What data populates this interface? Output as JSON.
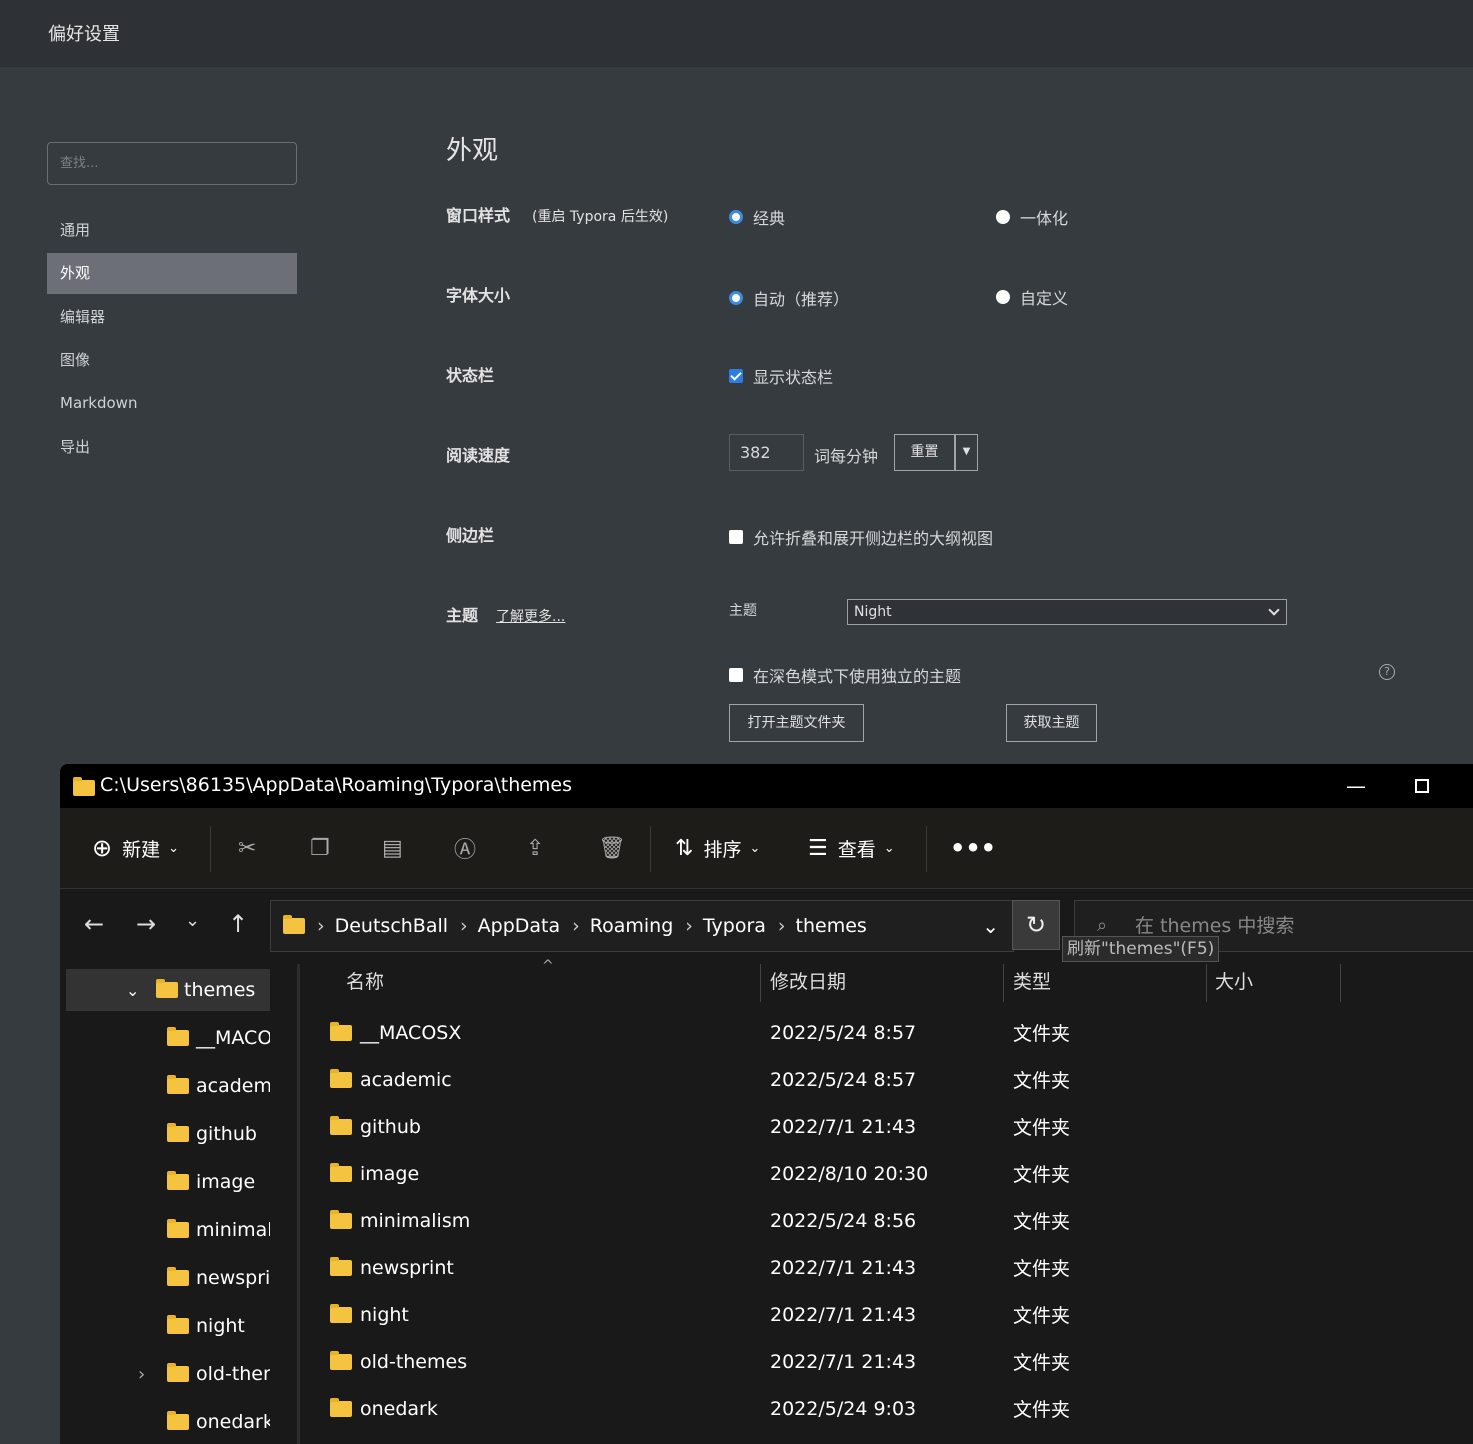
{
  "typora": {
    "window_title": "偏好设置",
    "search_placeholder": "查找...",
    "nav": [
      "通用",
      "外观",
      "编辑器",
      "图像",
      "Markdown",
      "导出"
    ],
    "section_title": "外观",
    "window_style": {
      "label": "窗口样式",
      "note": "(重启 Typora 后生效)",
      "options": [
        "经典",
        "一体化"
      ],
      "selected": "经典"
    },
    "font_size": {
      "label": "字体大小",
      "options": [
        "自动（推荐）",
        "自定义"
      ],
      "selected": "自动（推荐）"
    },
    "status_bar": {
      "label": "状态栏",
      "checkbox": "显示状态栏",
      "checked": true
    },
    "reading_speed": {
      "label": "阅读速度",
      "value": "382",
      "unit": "词每分钟",
      "reset": "重置"
    },
    "sidebar": {
      "label": "侧边栏",
      "checkbox": "允许折叠和展开侧边栏的大纲视图",
      "checked": false
    },
    "theme": {
      "label": "主题",
      "learn_more": "了解更多...",
      "select_label": "主题",
      "selected": "Night",
      "dark_checkbox": "在深色模式下使用独立的主题",
      "open_folder": "打开主题文件夹",
      "get_themes": "获取主题"
    }
  },
  "explorer": {
    "title": "C:\\Users\\86135\\AppData\\Roaming\\Typora\\themes",
    "toolbar": {
      "new": "新建",
      "sort": "排序",
      "view": "查看"
    },
    "breadcrumb": [
      "DeutschBall",
      "AppData",
      "Roaming",
      "Typora",
      "themes"
    ],
    "search_placeholder": "在 themes 中搜索",
    "tooltip": "刷新\"themes\"(F5)",
    "tree": [
      "themes",
      "__MACO",
      "academi",
      "github",
      "image",
      "minimali",
      "newsprir",
      "night",
      "old-then",
      "onedark"
    ],
    "columns": [
      "名称",
      "修改日期",
      "类型",
      "大小"
    ],
    "files": [
      {
        "name": "__MACOSX",
        "date": "2022/5/24 8:57",
        "type": "文件夹"
      },
      {
        "name": "academic",
        "date": "2022/5/24 8:57",
        "type": "文件夹"
      },
      {
        "name": "github",
        "date": "2022/7/1 21:43",
        "type": "文件夹"
      },
      {
        "name": "image",
        "date": "2022/8/10 20:30",
        "type": "文件夹"
      },
      {
        "name": "minimalism",
        "date": "2022/5/24 8:56",
        "type": "文件夹"
      },
      {
        "name": "newsprint",
        "date": "2022/7/1 21:43",
        "type": "文件夹"
      },
      {
        "name": "night",
        "date": "2022/7/1 21:43",
        "type": "文件夹"
      },
      {
        "name": "old-themes",
        "date": "2022/7/1 21:43",
        "type": "文件夹"
      },
      {
        "name": "onedark",
        "date": "2022/5/24 9:03",
        "type": "文件夹"
      }
    ]
  }
}
